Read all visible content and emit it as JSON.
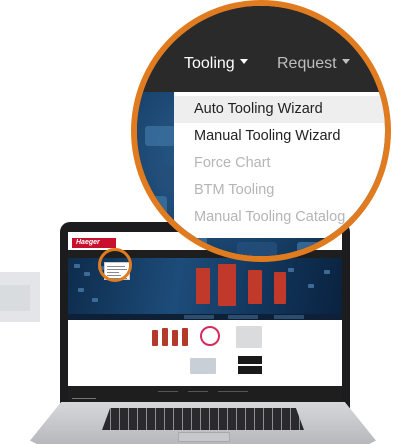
{
  "nav": {
    "tooling_label": "Tooling",
    "request_label": "Request"
  },
  "tooling_menu": {
    "items": [
      {
        "label": "Auto Tooling Wizard",
        "state": "highlighted"
      },
      {
        "label": "Manual Tooling Wizard",
        "state": "enabled"
      },
      {
        "label": "Force Chart",
        "state": "disabled"
      },
      {
        "label": "BTM Tooling",
        "state": "disabled"
      },
      {
        "label": "Manual Tooling Catalog",
        "state": "disabled"
      }
    ]
  },
  "site": {
    "logo_text": "Haeger"
  },
  "colors": {
    "highlight_ring": "#e07b1f",
    "nav_bar": "#2a2a2a",
    "brand_red": "#c8102e",
    "menu_text": "#222222",
    "menu_disabled": "#b5b5b5"
  }
}
